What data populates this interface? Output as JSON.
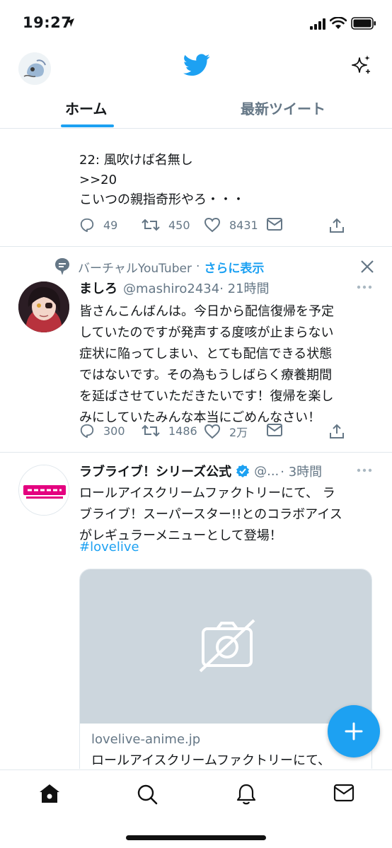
{
  "status_bar": {
    "time": "19:27"
  },
  "header": {
    "tabs": [
      {
        "label": "ホーム",
        "active": true
      },
      {
        "label": "最新ツイート",
        "active": false
      }
    ],
    "accent_color": "#1da1f2"
  },
  "tweets": [
    {
      "text": "22: 風吹けば名無し\n>>20\nこいつの親指奇形やろ・・・",
      "replies": "49",
      "retweets": "450",
      "likes": "8431"
    },
    {
      "topic": "バーチャルYouTuber",
      "topic_sep": "·",
      "topic_link": "さらに表示",
      "name": "ましろ",
      "handle": "@mashiro2434",
      "time": "· 21時間",
      "text": "皆さんこんばんは。今日から配信復帰を予定\nしていたのですが発声する度咳が止まらない\n症状に陥ってしまい、とても配信できる状態\nではないです。その為もうしばらく療養期間\nを延ばさせていただきたいです！復帰を楽し\nみにしていたみんな本当にごめんなさい！",
      "replies": "300",
      "retweets": "1486",
      "likes": "2万"
    },
    {
      "name": "ラブライブ！シリーズ公式",
      "handle": "@...",
      "time": "· 3時間",
      "text": "ロールアイスクリームファクトリーにて、 ラ\nブライブ！スーパースター!!とのコラボアイス\nがレギュラーメニューとして登場！",
      "hashtag": "#lovelive",
      "card": {
        "domain": "lovelive-anime.jp",
        "title": "ロールアイスクリームファクトリーにて、"
      }
    }
  ],
  "tab_bar": {
    "items": [
      "home-icon",
      "search-icon",
      "notifications-icon",
      "messages-icon"
    ]
  }
}
